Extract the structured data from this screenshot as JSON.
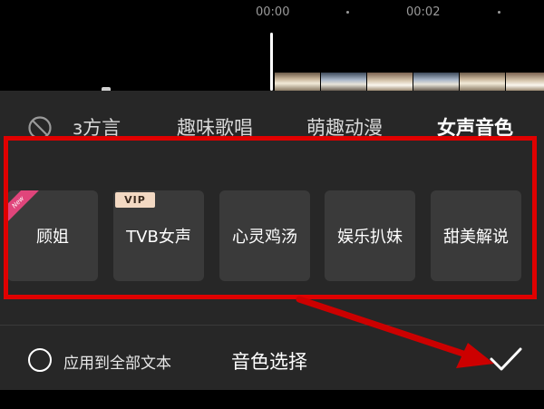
{
  "timeline": {
    "time_start": "00:00",
    "time_next": "00:02"
  },
  "tabs": [
    {
      "label": "з方言"
    },
    {
      "label": "趣味歌唱"
    },
    {
      "label": "萌趣动漫"
    },
    {
      "label": "女声音色",
      "active": true
    }
  ],
  "voices": [
    {
      "label": "顾姐",
      "badge": "new"
    },
    {
      "label": "TVB女声",
      "badge": "VIP"
    },
    {
      "label": "心灵鸡汤"
    },
    {
      "label": "娱乐扒妹"
    },
    {
      "label": "甜美解说"
    }
  ],
  "badges": {
    "new": "New",
    "vip": "VIP"
  },
  "footer": {
    "apply_all_label": "应用到全部文本",
    "voice_select_label": "音色选择"
  },
  "colors": {
    "highlight": "#e00000",
    "panel_bg": "#272727",
    "card_bg": "#3a3a3a",
    "new_badge": "#e0457b",
    "vip_badge": "#f3d9c3"
  },
  "icons": {
    "none": "circle-slash-icon",
    "confirm": "checkmark-icon",
    "radio": "radio-circle-icon"
  }
}
